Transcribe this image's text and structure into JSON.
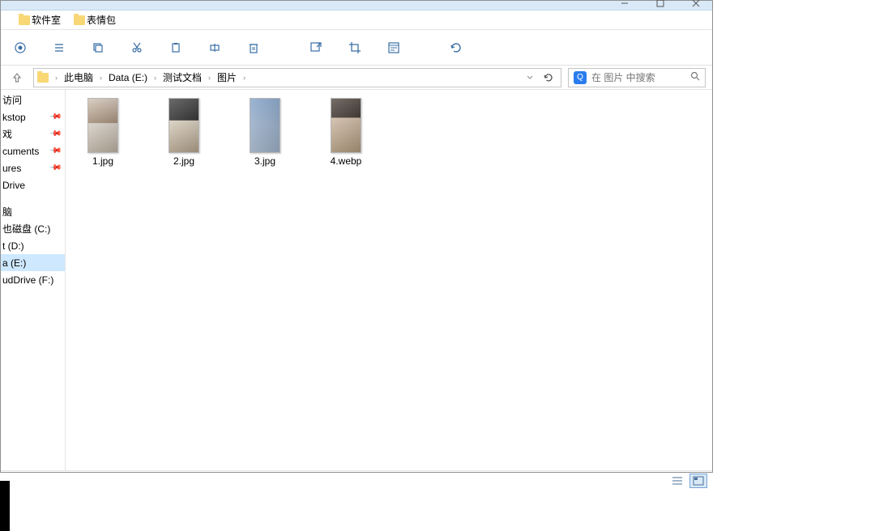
{
  "bookmarks": [
    {
      "label": "软件室"
    },
    {
      "label": "表情包"
    }
  ],
  "breadcrumbs": [
    {
      "label": "此电脑"
    },
    {
      "label": "Data (E:)"
    },
    {
      "label": "测试文档"
    },
    {
      "label": "图片"
    }
  ],
  "search": {
    "placeholder": "在 图片 中搜索"
  },
  "sidebar": {
    "section1": [
      {
        "label": "访问",
        "pinned": false
      },
      {
        "label": "kstop",
        "pinned": true
      },
      {
        "label": "戏",
        "pinned": true
      },
      {
        "label": "cuments",
        "pinned": true
      },
      {
        "label": "ures",
        "pinned": true
      },
      {
        "label": "Drive",
        "pinned": false
      }
    ],
    "section2": [
      {
        "label": "脑",
        "pinned": false
      },
      {
        "label": "也磁盘 (C:)",
        "pinned": false
      },
      {
        "label": "t (D:)",
        "pinned": false
      },
      {
        "label": "a (E:)",
        "pinned": false,
        "active": true
      },
      {
        "label": "udDrive (F:)",
        "pinned": false
      }
    ]
  },
  "files": [
    {
      "name": "1.jpg",
      "thumb": "t1"
    },
    {
      "name": "2.jpg",
      "thumb": "t2"
    },
    {
      "name": "3.jpg",
      "thumb": "t3"
    },
    {
      "name": "4.webp",
      "thumb": "t4"
    }
  ]
}
